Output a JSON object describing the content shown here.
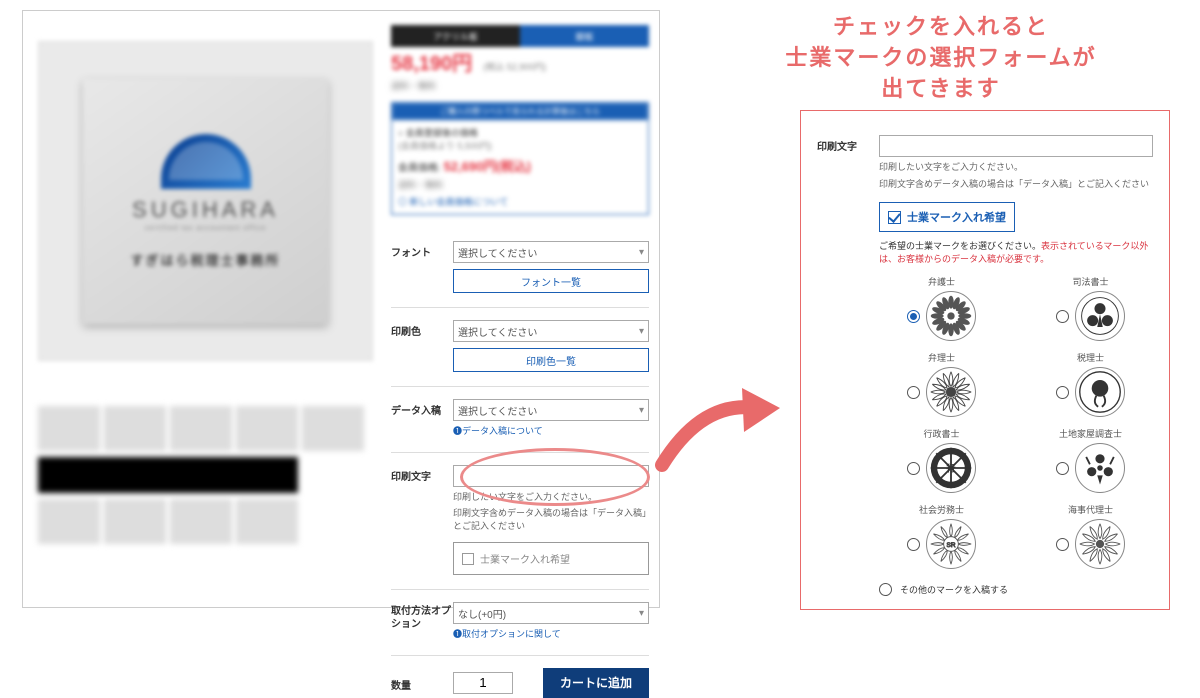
{
  "annotation": {
    "line1": "チェックを入れると",
    "line2": "士業マークの選択フォームが",
    "line3": "出てきます"
  },
  "product": {
    "brand": "SUGIHARA",
    "subline": "certified tax accountant office",
    "sample_text": "すぎはら税理士事務所"
  },
  "pricing": {
    "price": "58,190円",
    "tax_note": "(税込 52,900円)",
    "member_price": "52,690円(税込)"
  },
  "tabs": {
    "left": "アクリル板",
    "right": "銀板"
  },
  "form": {
    "font_label": "フォント",
    "font_placeholder": "選択してください",
    "font_list_btn": "フォント一覧",
    "color_label": "印刷色",
    "color_placeholder": "選択してください",
    "color_list_btn": "印刷色一覧",
    "data_label": "データ入稿",
    "data_placeholder": "選択してください",
    "data_link": "データ入稿について",
    "text_label": "印刷文字",
    "text_hint1": "印刷したい文字をご入力ください。",
    "text_hint2": "印刷文字含めデータ入稿の場合は「データ入稿」とご記入ください",
    "mark_checkbox": "士業マーク入れ希望",
    "mount_label": "取付方法オプション",
    "mount_value": "なし(+0円)",
    "mount_link": "取付オプションに関して",
    "qty_label": "数量",
    "qty_value": "1",
    "add_cart": "カートに追加"
  },
  "popup": {
    "text_label": "印刷文字",
    "hint1": "印刷したい文字をご入力ください。",
    "hint2": "印刷文字含めデータ入稿の場合は「データ入稿」とご記入ください",
    "checkbox": "士業マーク入れ希望",
    "select_hint": "ご希望の士業マークをお選びください。",
    "select_warn": "表示されているマーク以外は、お客様からのデータ入稿が必要です。",
    "marks": [
      {
        "label": "弁護士"
      },
      {
        "label": "司法書士"
      },
      {
        "label": "弁理士"
      },
      {
        "label": "税理士"
      },
      {
        "label": "行政書士"
      },
      {
        "label": "土地家屋調査士"
      },
      {
        "label": "社会労務士"
      },
      {
        "label": "海事代理士"
      }
    ],
    "other": "その他のマークを入稿する"
  }
}
